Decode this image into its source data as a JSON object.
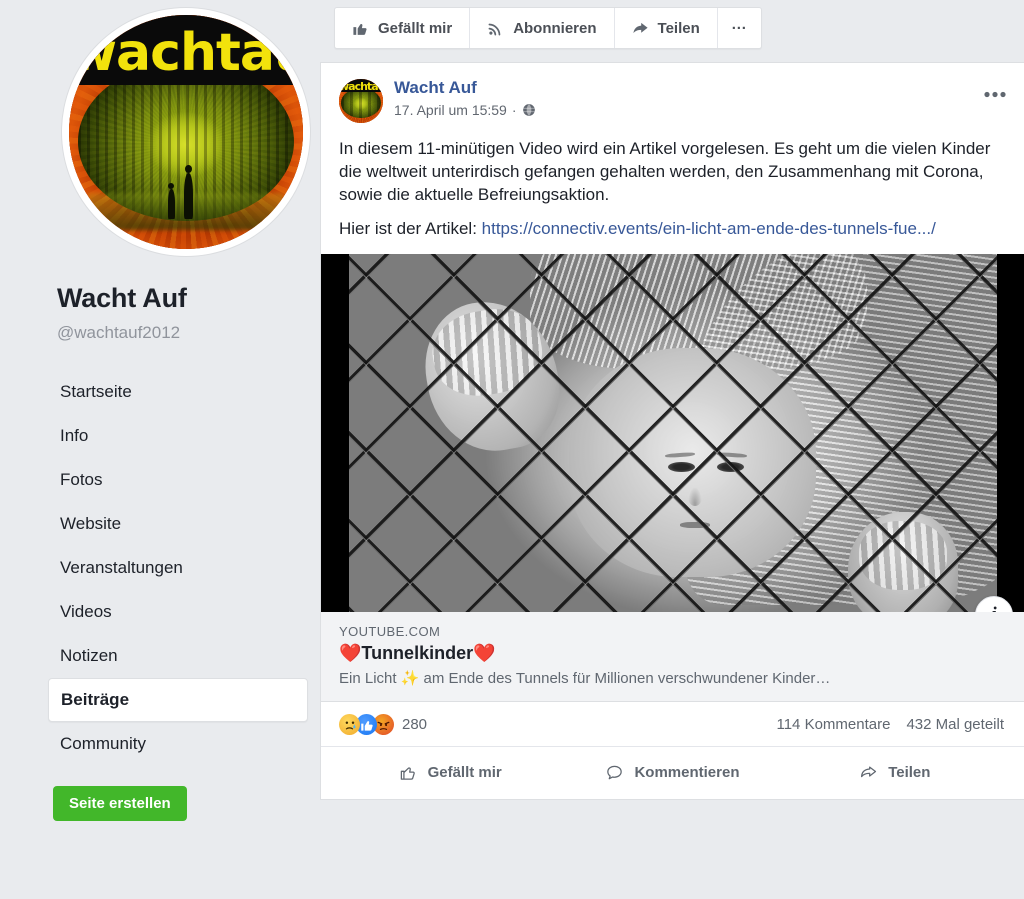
{
  "profile": {
    "name": "Wacht Auf",
    "handle": "@wachtauf2012",
    "avatar_wordmark": "wachtau"
  },
  "nav": {
    "items": [
      {
        "label": "Startseite",
        "active": false
      },
      {
        "label": "Info",
        "active": false
      },
      {
        "label": "Fotos",
        "active": false
      },
      {
        "label": "Website",
        "active": false
      },
      {
        "label": "Veranstaltungen",
        "active": false
      },
      {
        "label": "Videos",
        "active": false
      },
      {
        "label": "Notizen",
        "active": false
      },
      {
        "label": "Beiträge",
        "active": true
      },
      {
        "label": "Community",
        "active": false
      }
    ],
    "create_page_button": "Seite erstellen"
  },
  "topbar": {
    "like_label": "Gefällt mir",
    "follow_label": "Abonnieren",
    "share_label": "Teilen",
    "more_label": "···"
  },
  "post": {
    "author": "Wacht Auf",
    "timestamp": "17. April um 15:59",
    "privacy_separator": "·",
    "privacy_icon": "globe-icon",
    "menu_icon": "ellipsis-icon",
    "body_paragraph_1": "In diesem 11-minütigen Video wird ein Artikel vorgelesen. Es geht um die vielen Kinder die weltweit unterirdisch gefangen gehalten werden, den Zusammenhang mit Corona, sowie die aktuelle Befreiungsaktion.",
    "body_prefix_2": "Hier ist der Artikel: ",
    "body_link_2": "https://connectiv.events/ein-licht-am-ende-des-tunnels-fue.../",
    "media_info_button": "i",
    "link_card": {
      "domain": "YOUTUBE.COM",
      "title": "❤️Tunnelkinder❤️",
      "description": "Ein Licht ✨ am Ende des Tunnels für Millionen verschwundener Kinder…"
    },
    "stats": {
      "reaction_count": "280",
      "reactions": [
        "sad-reaction-icon",
        "like-reaction-icon",
        "angry-reaction-icon"
      ],
      "comments": "114 Kommentare",
      "shares": "432 Mal geteilt"
    },
    "actions": {
      "like_label": "Gefällt mir",
      "comment_label": "Kommentieren",
      "share_label": "Teilen"
    }
  },
  "colors": {
    "background": "#e9ebee",
    "card": "#ffffff",
    "link_blue": "#385898",
    "green_button": "#42b72a",
    "muted_text": "#606770",
    "primary_text": "#1d2129"
  }
}
